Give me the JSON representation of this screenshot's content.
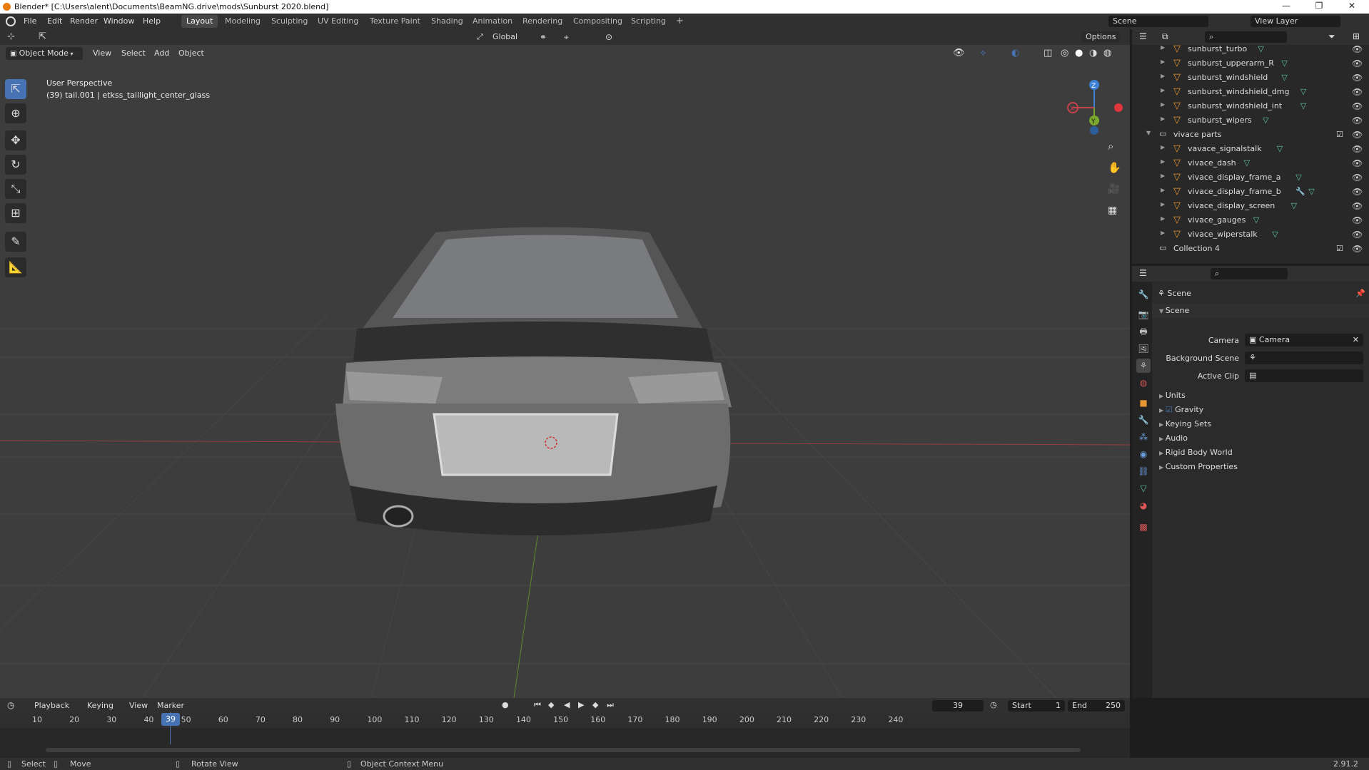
{
  "window": {
    "title": "Blender* [C:\\Users\\alent\\Documents\\BeamNG.drive\\mods\\Sunburst 2020.blend]",
    "minimize": "—",
    "maximize": "❐",
    "close": "✕"
  },
  "menu": [
    "File",
    "Edit",
    "Render",
    "Window",
    "Help"
  ],
  "workspaces": [
    "Layout",
    "Modeling",
    "Sculpting",
    "UV Editing",
    "Texture Paint",
    "Shading",
    "Animation",
    "Rendering",
    "Compositing",
    "Scripting"
  ],
  "active_workspace": "Layout",
  "add_workspace": "+",
  "scene_field": "Scene",
  "view_layer_field": "View Layer",
  "viewport": {
    "transform_orientation": "Global",
    "options_label": "Options",
    "mode": "Object Mode",
    "header_menus": [
      "View",
      "Select",
      "Add",
      "Object"
    ],
    "overlay_line1": "User Perspective",
    "overlay_line2": "(39) tail.001 | etkss_taillight_center_glass",
    "gizmo": {
      "z": "Z",
      "y": "Y",
      "x": "X"
    }
  },
  "outliner": {
    "rows": [
      {
        "label": "sunburst_turbo",
        "type": "mesh",
        "extra": ""
      },
      {
        "label": "sunburst_upperarm_R",
        "type": "mesh",
        "extra": ""
      },
      {
        "label": "sunburst_windshield",
        "type": "mesh",
        "extra": ""
      },
      {
        "label": "sunburst_windshield_dmg",
        "type": "mesh",
        "extra": ""
      },
      {
        "label": "sunburst_windshield_int",
        "type": "mesh",
        "extra": ""
      },
      {
        "label": "sunburst_wipers",
        "type": "mesh",
        "extra": ""
      },
      {
        "label": "vivace parts",
        "type": "collection",
        "extra": ""
      },
      {
        "label": "vavace_signalstalk",
        "type": "mesh",
        "extra": ""
      },
      {
        "label": "vivace_dash",
        "type": "mesh",
        "extra": ""
      },
      {
        "label": "vivace_display_frame_a",
        "type": "mesh",
        "extra": ""
      },
      {
        "label": "vivace_display_frame_b",
        "type": "mesh",
        "extra": "wrench"
      },
      {
        "label": "vivace_display_screen",
        "type": "mesh",
        "extra": ""
      },
      {
        "label": "vivace_gauges",
        "type": "mesh",
        "extra": ""
      },
      {
        "label": "vivace_wiperstalk",
        "type": "mesh",
        "extra": ""
      },
      {
        "label": "Collection 4",
        "type": "collection",
        "extra": ""
      }
    ]
  },
  "properties": {
    "breadcrumb": "Scene",
    "section_title": "Scene",
    "camera_label": "Camera",
    "camera_value": "Camera",
    "background_scene_label": "Background Scene",
    "active_clip_label": "Active Clip",
    "panels": [
      "Units",
      "Gravity",
      "Keying Sets",
      "Audio",
      "Rigid Body World",
      "Custom Properties"
    ]
  },
  "timeline": {
    "menus": [
      "Playback",
      "Keying",
      "View",
      "Marker"
    ],
    "current_frame": "39",
    "start_label": "Start",
    "start_value": "1",
    "end_label": "End",
    "end_value": "250",
    "ticks": [
      "10",
      "20",
      "30",
      "40",
      "50",
      "60",
      "70",
      "80",
      "90",
      "100",
      "110",
      "120",
      "130",
      "140",
      "150",
      "160",
      "170",
      "180",
      "190",
      "200",
      "210",
      "220",
      "230",
      "240"
    ]
  },
  "status": {
    "select": "Select",
    "move": "Move",
    "rotate": "Rotate View",
    "context": "Object Context Menu",
    "version": "2.91.2"
  },
  "colors": {
    "accent": "#4772b3",
    "x_axis": "#c7424a",
    "y_axis": "#7aa82d",
    "z_axis": "#3d82d6",
    "mesh_icon": "#e69632"
  }
}
